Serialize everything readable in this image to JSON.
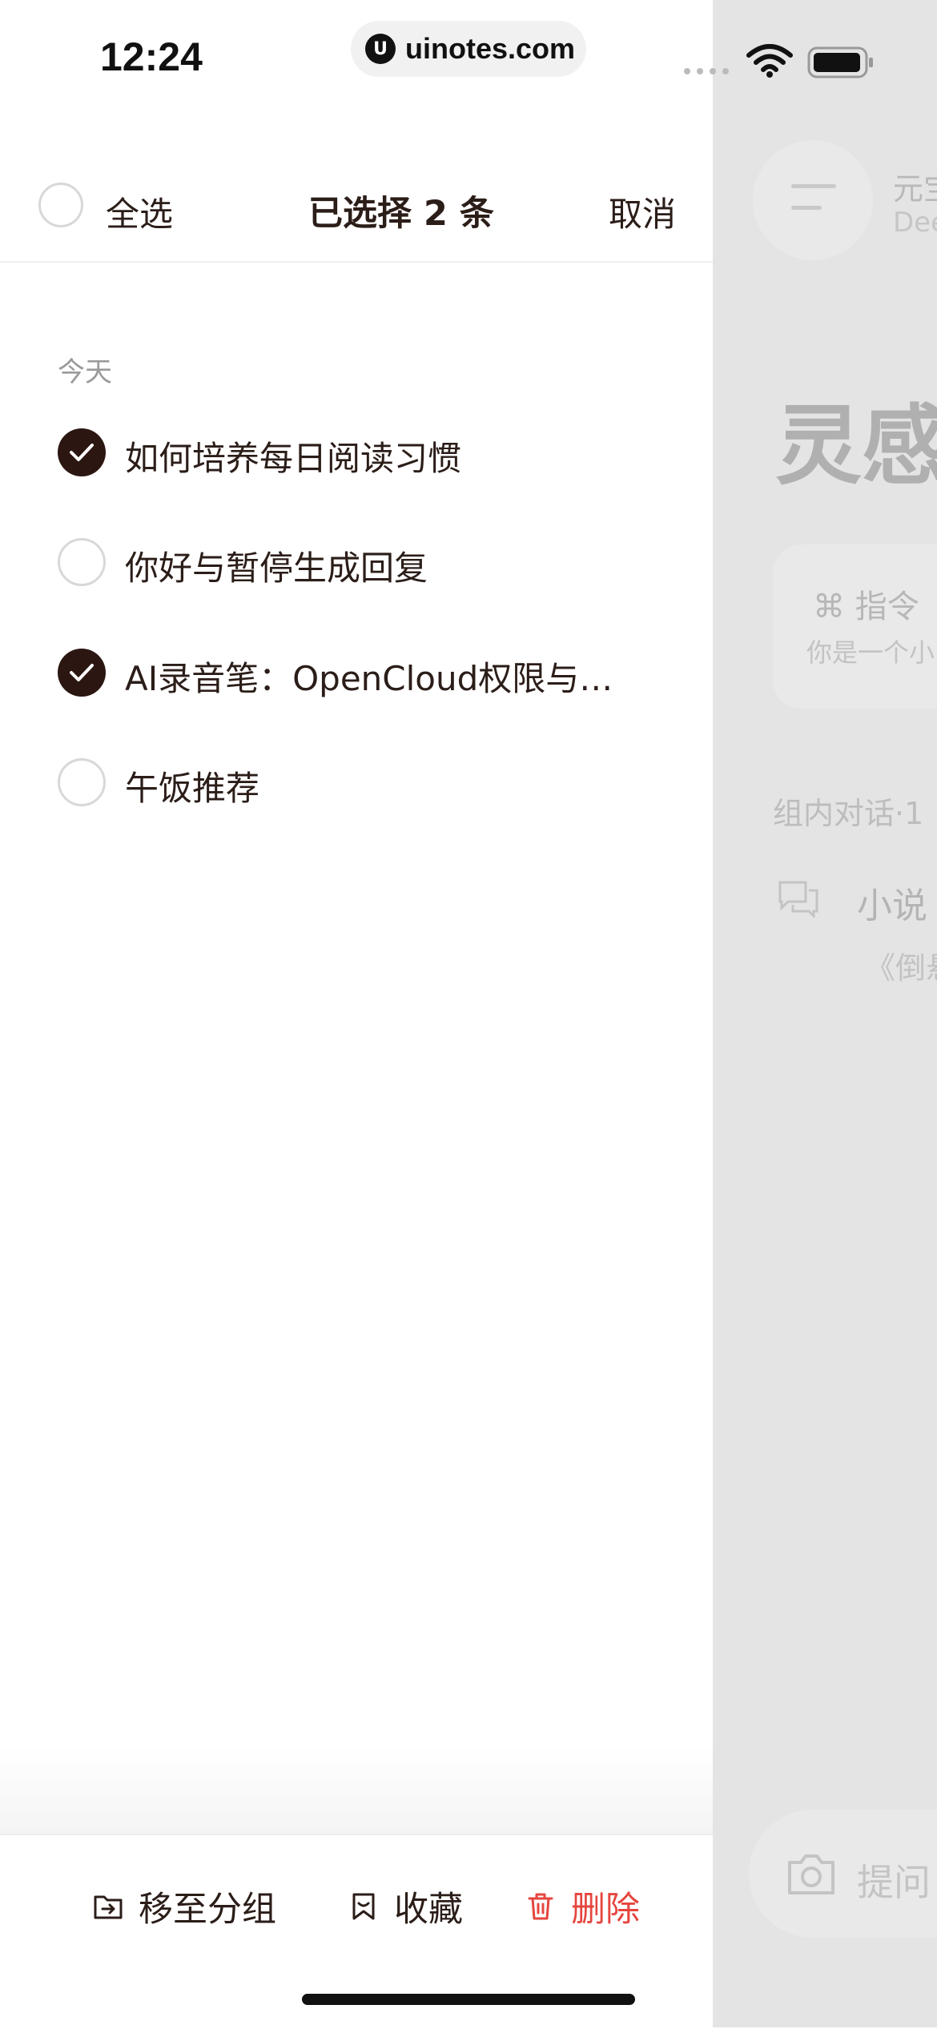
{
  "status_bar": {
    "time": "12:24",
    "url": "uinotes.com"
  },
  "header": {
    "select_all": "全选",
    "selected_count": "已选择 2 条",
    "cancel": "取消"
  },
  "section_label": "今天",
  "items": [
    {
      "title": "如何培养每日阅读习惯",
      "checked": true
    },
    {
      "title": "你好与暂停生成回复",
      "checked": false
    },
    {
      "title": "AI录音笔：OpenCloud权限与安…",
      "checked": true
    },
    {
      "title": "午饭推荐",
      "checked": false
    }
  ],
  "actions": {
    "move_to_group": "移至分组",
    "favorite": "收藏",
    "delete": "删除"
  },
  "background_page": {
    "title": "元宝",
    "subtitle": "Dee",
    "heading": "灵感",
    "card_title": "⌘ 指令",
    "card_text": "你是一个小",
    "group_label": "组内对话·1",
    "chat_title": "小说",
    "chat_preview": "《倒悬",
    "input_placeholder": "提问"
  },
  "colors": {
    "accent_dark": "#2b1611",
    "text": "#2b1d18",
    "delete_red": "#e5463f",
    "muted": "#9a9a9a"
  }
}
